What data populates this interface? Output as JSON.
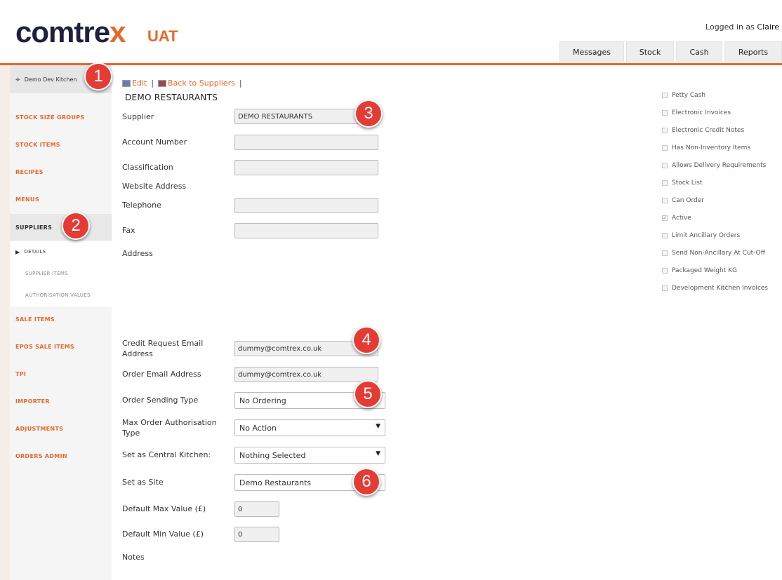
{
  "header": {
    "logo_main": "comtre",
    "logo_x": "x",
    "logo_uat": "UAT",
    "logged_in_prefix": "Logged in as",
    "user": "Claire",
    "tabs": [
      "Messages",
      "Stock",
      "Cash",
      "Reports"
    ]
  },
  "sidebar": {
    "site": "Demo Dev Kitchen",
    "items": [
      "STOCK SIZE GROUPS",
      "STOCK ITEMS",
      "RECIPES",
      "MENUS",
      "SUPPLIERS",
      "SALE ITEMS",
      "EPOS SALE ITEMS",
      "TPI",
      "IMPORTER",
      "ADJUSTMENTS",
      "ORDERS ADMIN"
    ],
    "sub_items": [
      "DETAILS",
      "SUPPLIER ITEMS",
      "AUTHORISATION VALUES"
    ]
  },
  "actions": {
    "edit": "Edit",
    "back": "Back to Suppliers",
    "sep": "|"
  },
  "page_title": "DEMO RESTAURANTS",
  "form": {
    "supplier": {
      "label": "Supplier",
      "value": "DEMO RESTAURANTS"
    },
    "account_number": {
      "label": "Account Number",
      "value": ""
    },
    "classification": {
      "label": "Classification",
      "value": ""
    },
    "website": {
      "label": "Website Address"
    },
    "telephone": {
      "label": "Telephone",
      "value": ""
    },
    "fax": {
      "label": "Fax",
      "value": ""
    },
    "address": {
      "label": "Address"
    },
    "credit_email": {
      "label_1": "Credit Request Email",
      "label_2": "Address",
      "value": "dummy@comtrex.co.uk"
    },
    "order_email": {
      "label": "Order Email Address",
      "value": "dummy@comtrex.co.uk"
    },
    "order_sending_type": {
      "label": "Order Sending Type",
      "value": "No Ordering"
    },
    "max_order_auth": {
      "label_1": "Max Order Authorisation",
      "label_2": "Type",
      "value": "No Action"
    },
    "central_kitchen": {
      "label": "Set as Central Kitchen:",
      "value": "Nothing Selected"
    },
    "site": {
      "label": "Set as Site",
      "value": "Demo Restaurants"
    },
    "default_max": {
      "label": "Default Max Value (£)",
      "value": "0"
    },
    "default_min": {
      "label": "Default Min Value (£)",
      "value": "0"
    },
    "notes": {
      "label": "Notes"
    }
  },
  "checkboxes": [
    {
      "label": "Petty Cash",
      "checked": false
    },
    {
      "label": "Electronic Invoices",
      "checked": false
    },
    {
      "label": "Electronic Credit Notes",
      "checked": false
    },
    {
      "label": "Has Non-Inventory Items",
      "checked": false
    },
    {
      "label": "Allows Delivery Requirements",
      "checked": false
    },
    {
      "label": "Stock List",
      "checked": false
    },
    {
      "label": "Can Order",
      "checked": false
    },
    {
      "label": "Active",
      "checked": true
    },
    {
      "label": "Limit Ancillary Orders",
      "checked": false
    },
    {
      "label": "Send Non-Ancillary At Cut-Off",
      "checked": false
    },
    {
      "label": "Packaged Weight KG",
      "checked": false
    },
    {
      "label": "Development Kitchen Invoices",
      "checked": false
    }
  ],
  "dropdown_arrow": "▼",
  "check_mark": "✓",
  "badges": [
    "1",
    "2",
    "3",
    "4",
    "5",
    "6"
  ],
  "colors": {
    "accent": "#e8682b",
    "brand_dark": "#1f2040",
    "badge": "#e53b35"
  }
}
